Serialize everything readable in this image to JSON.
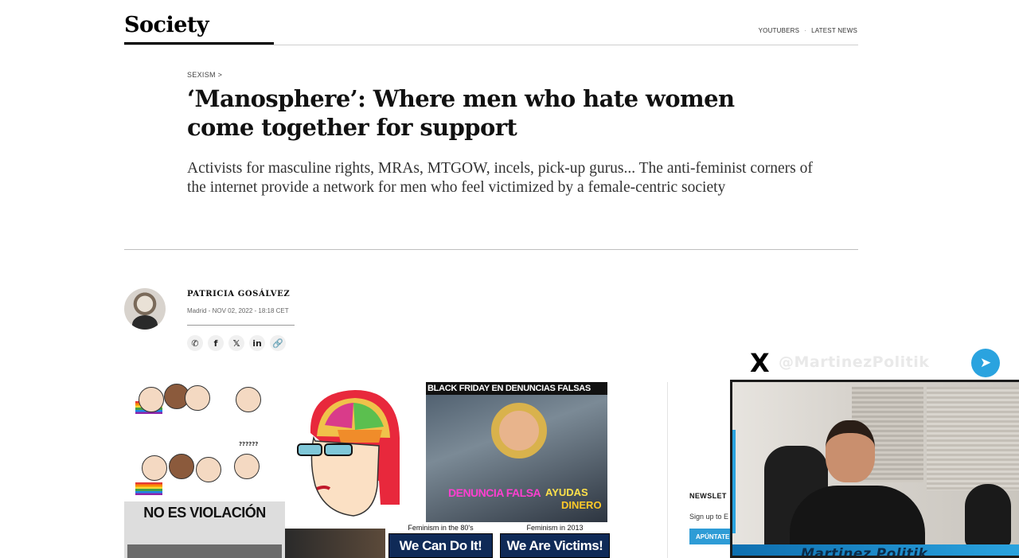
{
  "header": {
    "section": "Society",
    "nav": [
      "YOUTUBERS",
      "LATEST NEWS"
    ],
    "nav_separator": "·"
  },
  "article": {
    "kicker": "SEXISM >",
    "headline": "‘Manosphere’: Where men who hate women come together for support",
    "dek": "Activists for masculine rights, MRAs, MTGOW, incels, pick-up gurus... The anti-feminist corners of the internet provide a network for men who feel victimized by a female-centric society",
    "author": "PATRICIA GOSÁLVEZ",
    "dateline": "Madrid - NOV 02, 2022 - 18:18 CET",
    "share_icons": [
      "whatsapp-icon",
      "facebook-icon",
      "x-icon",
      "linkedin-icon",
      "link-icon"
    ],
    "share_glyphs": [
      "✆",
      "f",
      "𝕏",
      "in",
      "🔗"
    ]
  },
  "collage": {
    "memes_question": "??????",
    "beach_title": "BLACK FRIDAY EN DENUNCIAS FALSAS",
    "beach_text_1": "DENUNCIA FALSA",
    "beach_text_2": "AYUDAS",
    "beach_text_3": "DINERO",
    "noes_title": "NO ES VIOLACIÓN",
    "cando_caption": "Feminism in the 80's",
    "cando_text": "We Can Do It!",
    "victims_caption": "Feminism in 2013",
    "victims_text": "We Are Victims!"
  },
  "sidebar": {
    "newsletter_label": "NEWSLET",
    "newsletter_sub": "Sign up to E",
    "newsletter_button": "APÚNTATE"
  },
  "stream_overlay": {
    "x_glyph": "X",
    "handle": "@MartinezPolitik",
    "telegram_glyph": "➤",
    "name": "Martinez Politik"
  },
  "colors": {
    "telegram": "#2aa3df",
    "newsletter_button": "#2e9cd6"
  }
}
